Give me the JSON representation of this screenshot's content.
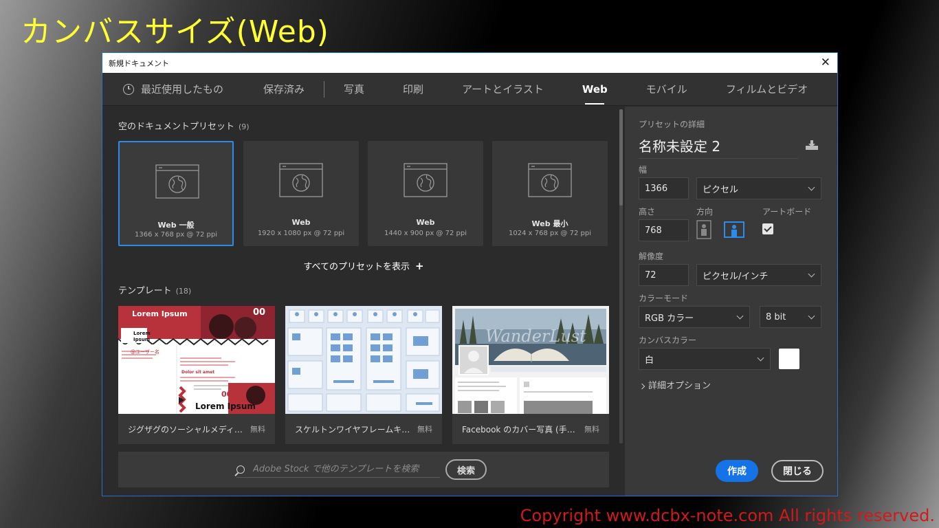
{
  "page": {
    "heading": "カンバスサイズ(Web)",
    "copyright": "Copyright www.dcbx-note.com All rights reserved."
  },
  "dialog": {
    "title": "新規ドキュメント",
    "close_label": "✕"
  },
  "tabs": [
    {
      "label": "最近使用したもの",
      "icon": "clock-icon"
    },
    {
      "label": "保存済み"
    },
    {
      "label": "写真"
    },
    {
      "label": "印刷"
    },
    {
      "label": "アートとイラスト"
    },
    {
      "label": "Web",
      "active": true
    },
    {
      "label": "モバイル"
    },
    {
      "label": "フィルムとビデオ"
    }
  ],
  "presets": {
    "title": "空のドキュメントプリセット",
    "count": "(9)",
    "items": [
      {
        "name": "Web 一般",
        "dimensions": "1366 x 768 px @ 72 ppi",
        "selected": true
      },
      {
        "name": "Web",
        "dimensions": "1920 x 1080 px @ 72 ppi"
      },
      {
        "name": "Web",
        "dimensions": "1440 x 900 px @ 72 ppi"
      },
      {
        "name": "Web 最小",
        "dimensions": "1024 x 768 px @ 72 ppi"
      }
    ],
    "show_all": "すべてのプリセットを表示",
    "show_all_icon": "+"
  },
  "templates": {
    "title": "テンプレート",
    "count": "(18)",
    "items": [
      {
        "name": "ジグザグのソーシャルメディアテンプレート",
        "price": "無料",
        "thumb_text": {
          "headline": "Lorem Ipsum",
          "badge": "00",
          "sub": "Lorem Ipsum",
          "label": "@ユーザー名",
          "dolor": "Dolor sit amet",
          "big": "Lorem Ipsum",
          "badge2": "00"
        }
      },
      {
        "name": "スケルトンワイヤフレームキット",
        "price": "無料"
      },
      {
        "name": "Facebook のカバー写真 (手順説明付き)",
        "price": "無料",
        "thumb_text": {
          "overlay": "WanderLust"
        }
      }
    ]
  },
  "stock": {
    "placeholder_brand": "Adobe Stock",
    "placeholder": "Adobe Stock で他のテンプレートを検索",
    "button": "検索"
  },
  "details": {
    "section_label": "プリセットの詳細",
    "preset_name": "名称未設定 2",
    "width_label": "幅",
    "width_value": "1366",
    "width_unit": "ピクセル",
    "height_label": "高さ",
    "height_value": "768",
    "orientation_label": "方向",
    "orientation": "landscape",
    "artboard_label": "アートボード",
    "artboard_checked": true,
    "resolution_label": "解像度",
    "resolution_value": "72",
    "resolution_unit": "ピクセル/インチ",
    "color_mode_label": "カラーモード",
    "color_mode": "RGB カラー",
    "bit_depth": "8 bit",
    "canvas_color_label": "カンバスカラー",
    "canvas_color": "白",
    "canvas_swatch": "#ffffff",
    "advanced": "詳細オプション",
    "create": "作成",
    "close": "閉じる"
  },
  "colors": {
    "accent": "#1473e6",
    "selection": "#2d8ceb",
    "heading": "#ffff33",
    "copyright": "#d11a1a"
  }
}
